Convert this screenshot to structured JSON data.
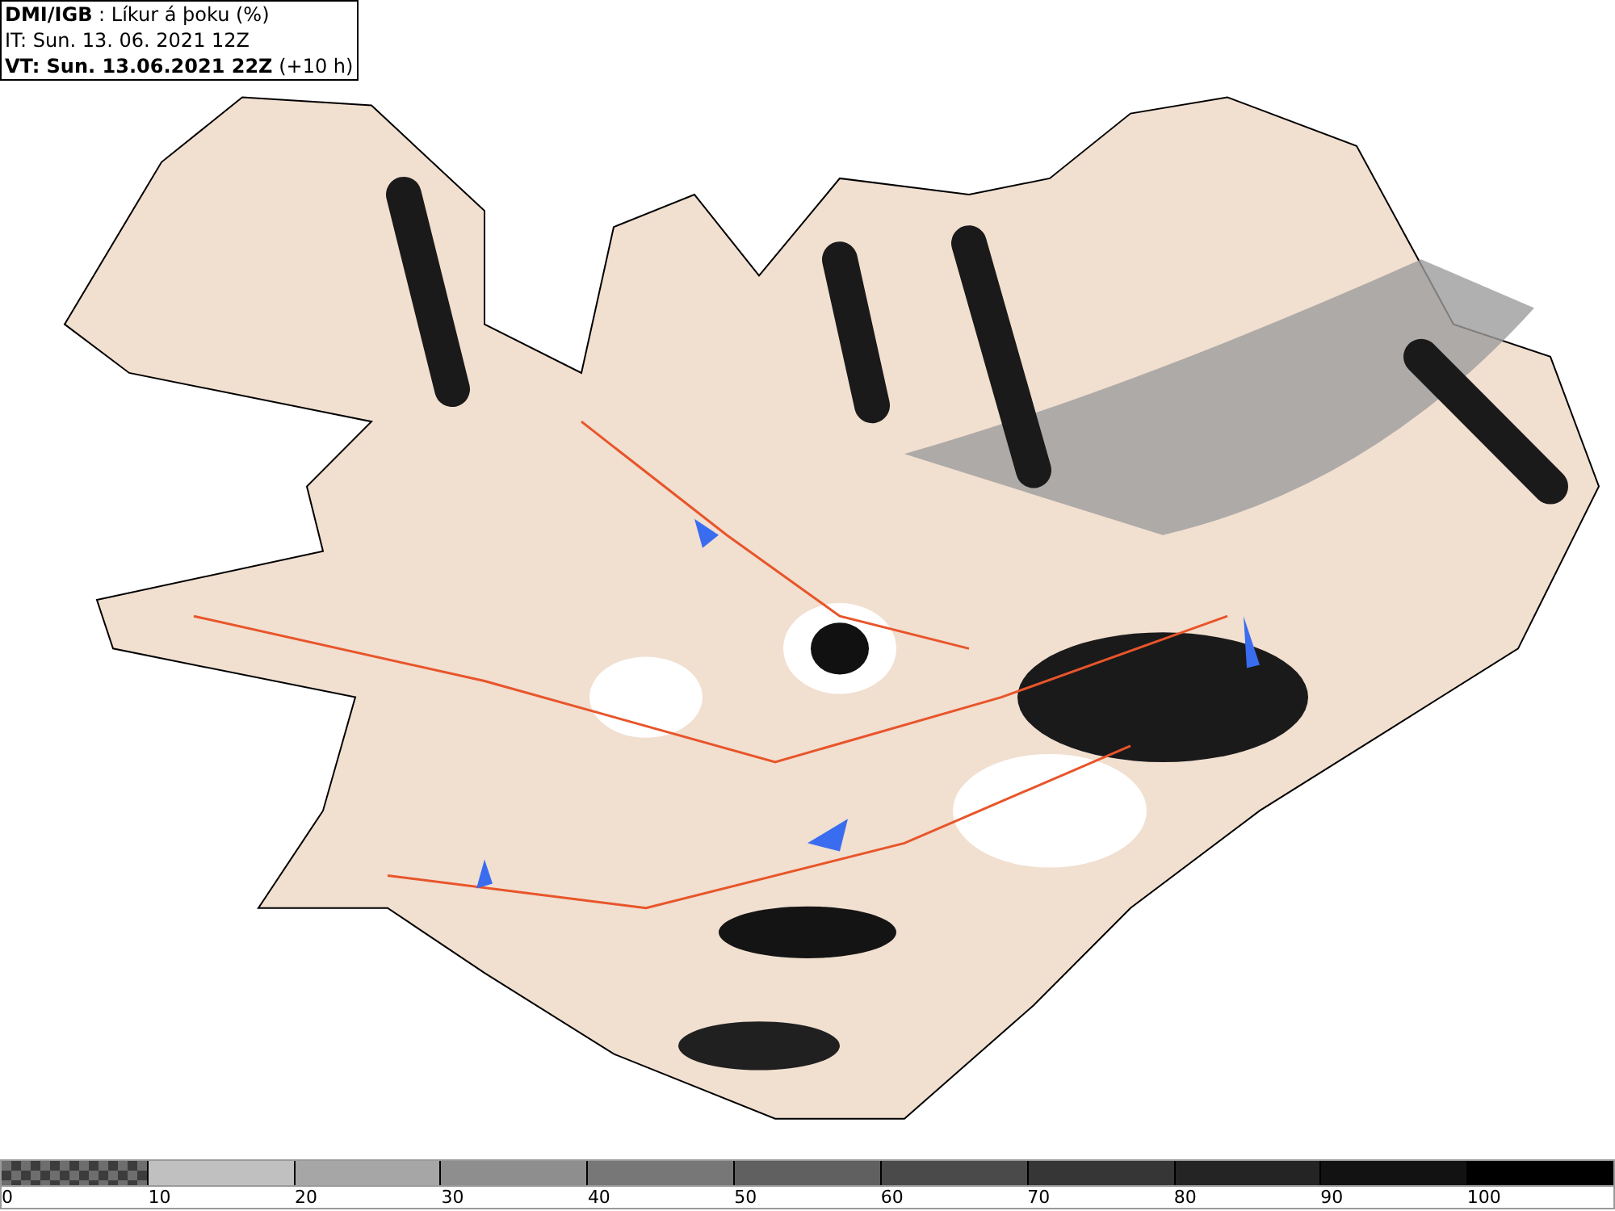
{
  "header": {
    "source": "DMI/IGB",
    "title": ": Líkur á þoku (%)",
    "issue_time": "IT: Sun. 13. 06. 2021 12Z",
    "valid_time": "VT: Sun. 13.06.2021 22Z",
    "valid_offset": "(+10 h)"
  },
  "legend": {
    "segments": [
      {
        "kind": "checkered",
        "color": "#6e6e6e"
      },
      {
        "kind": "solid",
        "color": "#c0c0c0"
      },
      {
        "kind": "solid",
        "color": "#a6a6a6"
      },
      {
        "kind": "solid",
        "color": "#8e8e8e"
      },
      {
        "kind": "solid",
        "color": "#777777"
      },
      {
        "kind": "solid",
        "color": "#606060"
      },
      {
        "kind": "solid",
        "color": "#4a4a4a"
      },
      {
        "kind": "solid",
        "color": "#363636"
      },
      {
        "kind": "solid",
        "color": "#242424"
      },
      {
        "kind": "solid",
        "color": "#121212"
      },
      {
        "kind": "solid",
        "color": "#000000"
      }
    ],
    "ticks": [
      "0",
      "10",
      "20",
      "30",
      "40",
      "50",
      "60",
      "70",
      "80",
      "90",
      "100"
    ]
  }
}
